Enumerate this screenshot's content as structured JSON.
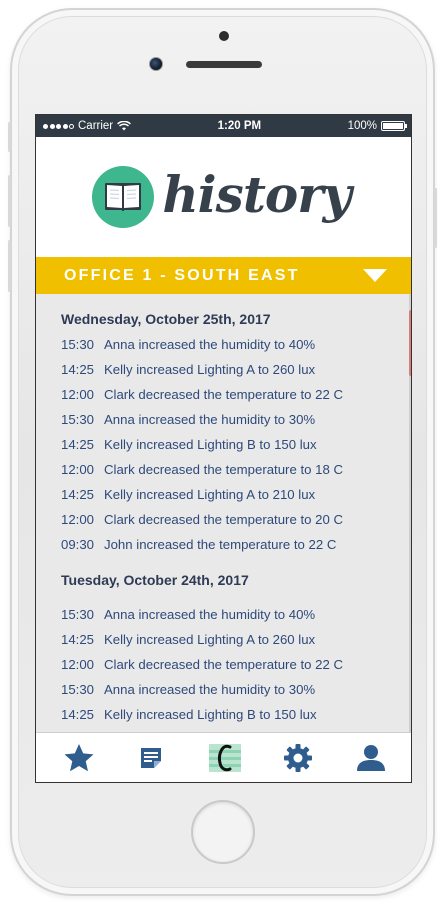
{
  "status_bar": {
    "carrier": "Carrier",
    "time": "1:20 PM",
    "battery": "100%"
  },
  "header": {
    "logo_icon": "book-icon",
    "title": "history"
  },
  "office_selector": {
    "label": "OFFICE 1 - SOUTH EAST",
    "icon": "triangle-down-icon"
  },
  "days": [
    {
      "date": "Wednesday, October 25th, 2017",
      "entries": [
        {
          "time": "15:30",
          "text": "Anna increased the humidity to 40%"
        },
        {
          "time": "14:25",
          "text": "Kelly increased Lighting A to 260 lux"
        },
        {
          "time": "12:00",
          "text": "Clark decreased the temperature to 22 C"
        },
        {
          "time": "15:30",
          "text": "Anna increased the humidity to 30%"
        },
        {
          "time": "14:25",
          "text": "Kelly increased Lighting B to 150 lux"
        },
        {
          "time": "12:00",
          "text": "Clark decreased the temperature to 18 C"
        },
        {
          "time": "14:25",
          "text": "Kelly increased Lighting A to 210 lux"
        },
        {
          "time": "12:00",
          "text": "Clark decreased the temperature to 20 C"
        },
        {
          "time": "09:30",
          "text": "John increased the temperature to 22 C"
        }
      ]
    },
    {
      "date": "Tuesday, October 24th, 2017",
      "entries": [
        {
          "time": "15:30",
          "text": "Anna increased the humidity to 40%"
        },
        {
          "time": "14:25",
          "text": "Kelly increased Lighting A to 260 lux"
        },
        {
          "time": "12:00",
          "text": "Clark decreased the temperature to 22 C"
        },
        {
          "time": "15:30",
          "text": "Anna increased the humidity to 30%"
        },
        {
          "time": "14:25",
          "text": "Kelly increased Lighting B to 150 lux"
        }
      ]
    }
  ],
  "tabs": [
    {
      "icon": "star-icon",
      "active": false
    },
    {
      "icon": "document-list-icon",
      "active": false
    },
    {
      "icon": "history-icon",
      "active": true
    },
    {
      "icon": "gear-icon",
      "active": false
    },
    {
      "icon": "user-icon",
      "active": false
    }
  ],
  "colors": {
    "accent_yellow": "#f0c000",
    "logo_green": "#3eb68e",
    "nav_blue": "#2e5d8e",
    "text_blue": "#2e4a7a",
    "status_bar": "#2f3a44"
  }
}
